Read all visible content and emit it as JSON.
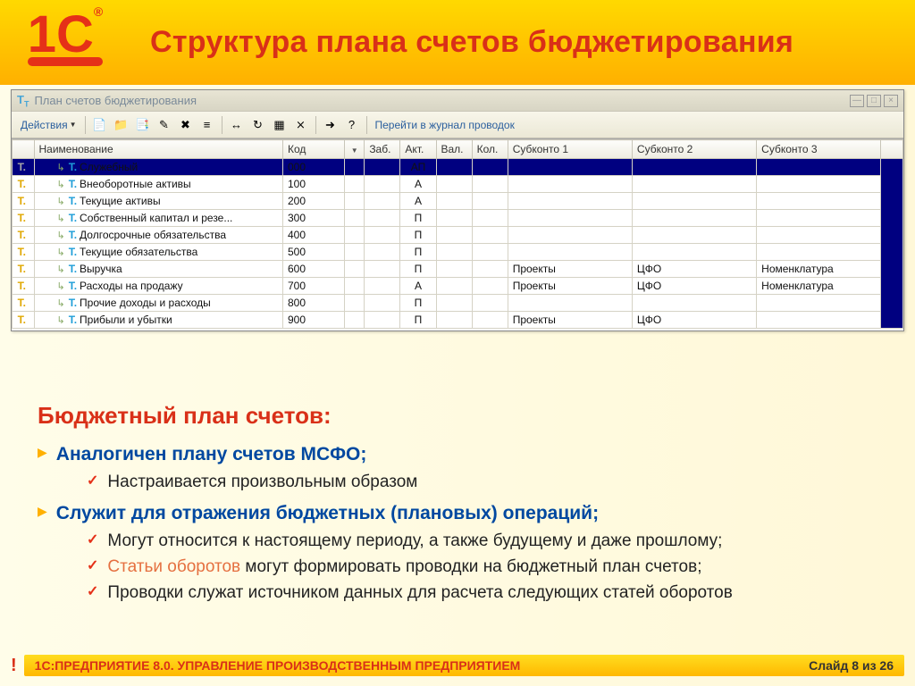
{
  "slide": {
    "title": "Структура плана счетов бюджетирования",
    "footer_label": "1С:ПРЕДПРИЯТИЕ 8.0. УПРАВЛЕНИЕ ПРОИЗВОДСТВЕННЫМ ПРЕДПРИЯТИЕМ",
    "page_indicator": "Слайд 8 из 26"
  },
  "window": {
    "title": "План счетов бюджетирования",
    "actions_label": "Действия",
    "journal_link": "Перейти в журнал проводок"
  },
  "columns": {
    "name": "Наименование",
    "code": "Код",
    "zab": "Заб.",
    "akt": "Акт.",
    "val": "Вал.",
    "kol": "Кол.",
    "sub1": "Субконто 1",
    "sub2": "Субконто 2",
    "sub3": "Субконто 3"
  },
  "rows": [
    {
      "name": "Служебный",
      "code": "000",
      "akt": "АП",
      "sub1": "",
      "sub2": "",
      "sub3": "",
      "selected": true
    },
    {
      "name": "Внеоборотные активы",
      "code": "100",
      "akt": "А",
      "sub1": "",
      "sub2": "",
      "sub3": ""
    },
    {
      "name": "Текущие активы",
      "code": "200",
      "akt": "А",
      "sub1": "",
      "sub2": "",
      "sub3": ""
    },
    {
      "name": "Собственный капитал и резе...",
      "code": "300",
      "akt": "П",
      "sub1": "",
      "sub2": "",
      "sub3": ""
    },
    {
      "name": "Долгосрочные обязательства",
      "code": "400",
      "akt": "П",
      "sub1": "",
      "sub2": "",
      "sub3": ""
    },
    {
      "name": "Текущие обязательства",
      "code": "500",
      "akt": "П",
      "sub1": "",
      "sub2": "",
      "sub3": ""
    },
    {
      "name": "Выручка",
      "code": "600",
      "akt": "П",
      "sub1": "Проекты",
      "sub2": "ЦФО",
      "sub3": "Номенклатура"
    },
    {
      "name": "Расходы на продажу",
      "code": "700",
      "akt": "А",
      "sub1": "Проекты",
      "sub2": "ЦФО",
      "sub3": "Номенклатура"
    },
    {
      "name": "Прочие доходы и расходы",
      "code": "800",
      "akt": "П",
      "sub1": "",
      "sub2": "",
      "sub3": ""
    },
    {
      "name": "Прибыли и убытки",
      "code": "900",
      "akt": "П",
      "sub1": "Проекты",
      "sub2": "ЦФО",
      "sub3": ""
    }
  ],
  "body": {
    "heading": "Бюджетный план счетов:",
    "items": [
      {
        "text": "Аналогичен плану счетов МСФО;",
        "sub": [
          {
            "text": "Настраивается произвольным образом"
          }
        ]
      },
      {
        "text": "Служит для отражения бюджетных (плановых) операций;",
        "sub": [
          {
            "text": "Могут относится к настоящему периоду, а также будущему и даже прошлому;"
          },
          {
            "accent": "Статьи оборотов",
            "rest": " могут формировать проводки на бюджетный план счетов;"
          },
          {
            "text": "Проводки служат источником данных для расчета следующих статей оборотов"
          }
        ]
      }
    ]
  }
}
